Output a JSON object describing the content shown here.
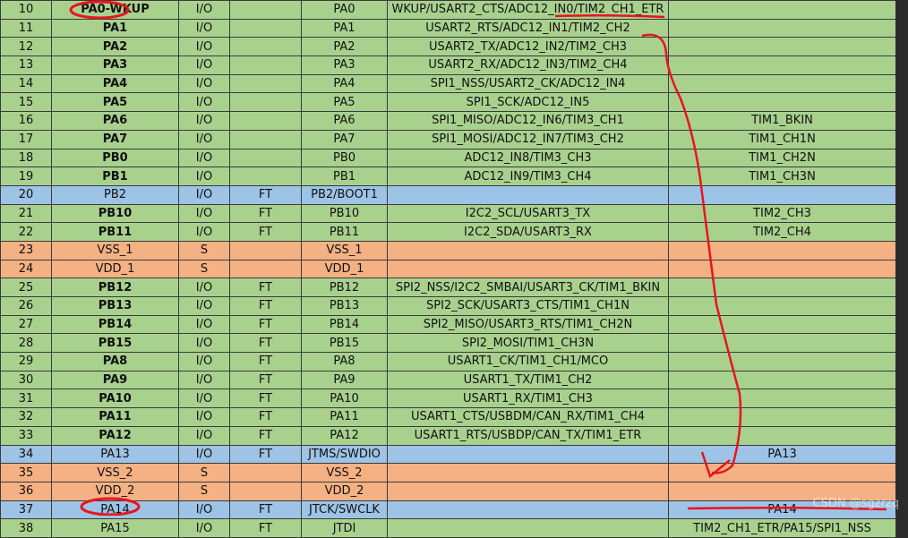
{
  "watermark": "CSDN @sgzrzq",
  "rows": [
    {
      "num": "10",
      "name": "PA0-WKUP",
      "type": "I/O",
      "ft": "",
      "main": "PA0",
      "alt": "WKUP/USART2_CTS/ADC12_IN0/TIM2_CH1_ETR",
      "remap": "",
      "color": "green",
      "bold": true
    },
    {
      "num": "11",
      "name": "PA1",
      "type": "I/O",
      "ft": "",
      "main": "PA1",
      "alt": "USART2_RTS/ADC12_IN1/TIM2_CH2",
      "remap": "",
      "color": "green",
      "bold": true
    },
    {
      "num": "12",
      "name": "PA2",
      "type": "I/O",
      "ft": "",
      "main": "PA2",
      "alt": "USART2_TX/ADC12_IN2/TIM2_CH3",
      "remap": "",
      "color": "green",
      "bold": true
    },
    {
      "num": "13",
      "name": "PA3",
      "type": "I/O",
      "ft": "",
      "main": "PA3",
      "alt": "USART2_RX/ADC12_IN3/TIM2_CH4",
      "remap": "",
      "color": "green",
      "bold": true
    },
    {
      "num": "14",
      "name": "PA4",
      "type": "I/O",
      "ft": "",
      "main": "PA4",
      "alt": "SPI1_NSS/USART2_CK/ADC12_IN4",
      "remap": "",
      "color": "green",
      "bold": true
    },
    {
      "num": "15",
      "name": "PA5",
      "type": "I/O",
      "ft": "",
      "main": "PA5",
      "alt": "SPI1_SCK/ADC12_IN5",
      "remap": "",
      "color": "green",
      "bold": true
    },
    {
      "num": "16",
      "name": "PA6",
      "type": "I/O",
      "ft": "",
      "main": "PA6",
      "alt": "SPI1_MISO/ADC12_IN6/TIM3_CH1",
      "remap": "TIM1_BKIN",
      "color": "green",
      "bold": true
    },
    {
      "num": "17",
      "name": "PA7",
      "type": "I/O",
      "ft": "",
      "main": "PA7",
      "alt": "SPI1_MOSI/ADC12_IN7/TIM3_CH2",
      "remap": "TIM1_CH1N",
      "color": "green",
      "bold": true
    },
    {
      "num": "18",
      "name": "PB0",
      "type": "I/O",
      "ft": "",
      "main": "PB0",
      "alt": "ADC12_IN8/TIM3_CH3",
      "remap": "TIM1_CH2N",
      "color": "green",
      "bold": true
    },
    {
      "num": "19",
      "name": "PB1",
      "type": "I/O",
      "ft": "",
      "main": "PB1",
      "alt": "ADC12_IN9/TIM3_CH4",
      "remap": "TIM1_CH3N",
      "color": "green",
      "bold": true
    },
    {
      "num": "20",
      "name": "PB2",
      "type": "I/O",
      "ft": "FT",
      "main": "PB2/BOOT1",
      "alt": "",
      "remap": "",
      "color": "blue",
      "bold": false
    },
    {
      "num": "21",
      "name": "PB10",
      "type": "I/O",
      "ft": "FT",
      "main": "PB10",
      "alt": "I2C2_SCL/USART3_TX",
      "remap": "TIM2_CH3",
      "color": "green",
      "bold": true
    },
    {
      "num": "22",
      "name": "PB11",
      "type": "I/O",
      "ft": "FT",
      "main": "PB11",
      "alt": "I2C2_SDA/USART3_RX",
      "remap": "TIM2_CH4",
      "color": "green",
      "bold": true
    },
    {
      "num": "23",
      "name": "VSS_1",
      "type": "S",
      "ft": "",
      "main": "VSS_1",
      "alt": "",
      "remap": "",
      "color": "orange",
      "bold": false
    },
    {
      "num": "24",
      "name": "VDD_1",
      "type": "S",
      "ft": "",
      "main": "VDD_1",
      "alt": "",
      "remap": "",
      "color": "orange",
      "bold": false
    },
    {
      "num": "25",
      "name": "PB12",
      "type": "I/O",
      "ft": "FT",
      "main": "PB12",
      "alt": "SPI2_NSS/I2C2_SMBAI/USART3_CK/TIM1_BKIN",
      "remap": "",
      "color": "green",
      "bold": true
    },
    {
      "num": "26",
      "name": "PB13",
      "type": "I/O",
      "ft": "FT",
      "main": "PB13",
      "alt": "SPI2_SCK/USART3_CTS/TIM1_CH1N",
      "remap": "",
      "color": "green",
      "bold": true
    },
    {
      "num": "27",
      "name": "PB14",
      "type": "I/O",
      "ft": "FT",
      "main": "PB14",
      "alt": "SPI2_MISO/USART3_RTS/TIM1_CH2N",
      "remap": "",
      "color": "green",
      "bold": true
    },
    {
      "num": "28",
      "name": "PB15",
      "type": "I/O",
      "ft": "FT",
      "main": "PB15",
      "alt": "SPI2_MOSI/TIM1_CH3N",
      "remap": "",
      "color": "green",
      "bold": true
    },
    {
      "num": "29",
      "name": "PA8",
      "type": "I/O",
      "ft": "FT",
      "main": "PA8",
      "alt": "USART1_CK/TIM1_CH1/MCO",
      "remap": "",
      "color": "green",
      "bold": true
    },
    {
      "num": "30",
      "name": "PA9",
      "type": "I/O",
      "ft": "FT",
      "main": "PA9",
      "alt": "USART1_TX/TIM1_CH2",
      "remap": "",
      "color": "green",
      "bold": true
    },
    {
      "num": "31",
      "name": "PA10",
      "type": "I/O",
      "ft": "FT",
      "main": "PA10",
      "alt": "USART1_RX/TIM1_CH3",
      "remap": "",
      "color": "green",
      "bold": true
    },
    {
      "num": "32",
      "name": "PA11",
      "type": "I/O",
      "ft": "FT",
      "main": "PA11",
      "alt": "USART1_CTS/USBDM/CAN_RX/TIM1_CH4",
      "remap": "",
      "color": "green",
      "bold": true
    },
    {
      "num": "33",
      "name": "PA12",
      "type": "I/O",
      "ft": "FT",
      "main": "PA12",
      "alt": "USART1_RTS/USBDP/CAN_TX/TIM1_ETR",
      "remap": "",
      "color": "green",
      "bold": true
    },
    {
      "num": "34",
      "name": "PA13",
      "type": "I/O",
      "ft": "FT",
      "main": "JTMS/SWDIO",
      "alt": "",
      "remap": "PA13",
      "color": "blue",
      "bold": false
    },
    {
      "num": "35",
      "name": "VSS_2",
      "type": "S",
      "ft": "",
      "main": "VSS_2",
      "alt": "",
      "remap": "",
      "color": "orange",
      "bold": false
    },
    {
      "num": "36",
      "name": "VDD_2",
      "type": "S",
      "ft": "",
      "main": "VDD_2",
      "alt": "",
      "remap": "",
      "color": "orange",
      "bold": false
    },
    {
      "num": "37",
      "name": "PA14",
      "type": "I/O",
      "ft": "FT",
      "main": "JTCK/SWCLK",
      "alt": "",
      "remap": "PA14",
      "color": "blue",
      "bold": false
    },
    {
      "num": "38",
      "name": "PA15",
      "type": "I/O",
      "ft": "FT",
      "main": "JTDI",
      "alt": "",
      "remap": "TIM2_CH1_ETR/PA15/SPI1_NSS",
      "color": "green",
      "bold": false
    }
  ],
  "annotation_color": "#e8141e"
}
